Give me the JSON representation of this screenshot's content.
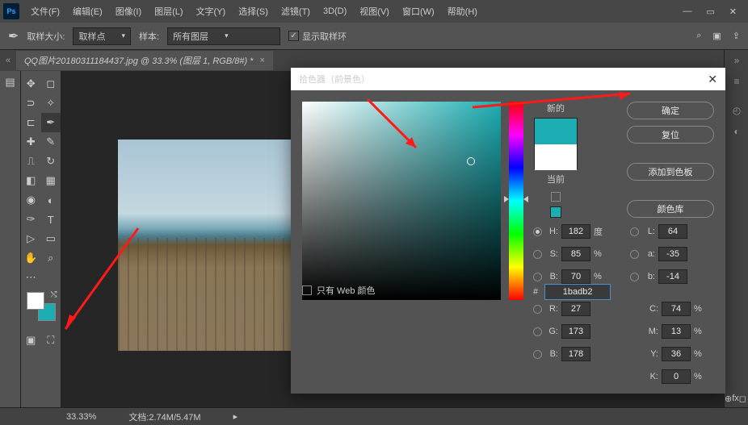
{
  "menu": {
    "file": "文件(F)",
    "edit": "编辑(E)",
    "image": "图像(I)",
    "layer": "图层(L)",
    "type": "文字(Y)",
    "select": "选择(S)",
    "filter": "滤镜(T)",
    "threeD": "3D(D)",
    "view": "视图(V)",
    "window": "窗口(W)",
    "help": "帮助(H)"
  },
  "optbar": {
    "sample_size_lbl": "取样大小:",
    "sample_size_val": "取样点",
    "sample_lbl": "样本:",
    "sample_val": "所有图层",
    "show_ring": "显示取样环"
  },
  "doc": {
    "tab": "QQ图片20180311184437.jpg @ 33.3% (图层 1, RGB/8#) *"
  },
  "picker": {
    "title": "拾色器（前景色）",
    "ok": "确定",
    "reset": "复位",
    "add_swatch": "添加到色板",
    "color_lib": "颜色库",
    "new_lbl": "新的",
    "cur_lbl": "当前",
    "web_only": "只有 Web 颜色",
    "H": {
      "lbl": "H:",
      "val": "182",
      "unit": "度"
    },
    "S": {
      "lbl": "S:",
      "val": "85",
      "unit": "%"
    },
    "Bv": {
      "lbl": "B:",
      "val": "70",
      "unit": "%"
    },
    "R": {
      "lbl": "R:",
      "val": "27"
    },
    "G": {
      "lbl": "G:",
      "val": "173"
    },
    "Bb": {
      "lbl": "B:",
      "val": "178"
    },
    "L": {
      "lbl": "L:",
      "val": "64"
    },
    "a": {
      "lbl": "a:",
      "val": "-35"
    },
    "b": {
      "lbl": "b:",
      "val": "-14"
    },
    "C": {
      "lbl": "C:",
      "val": "74",
      "unit": "%"
    },
    "M": {
      "lbl": "M:",
      "val": "13",
      "unit": "%"
    },
    "Y": {
      "lbl": "Y:",
      "val": "36",
      "unit": "%"
    },
    "K": {
      "lbl": "K:",
      "val": "0",
      "unit": "%"
    },
    "hex_lbl": "#",
    "hex": "1badb2"
  },
  "status": {
    "zoom": "33.33%",
    "docsize": "文档:2.74M/5.47M"
  }
}
